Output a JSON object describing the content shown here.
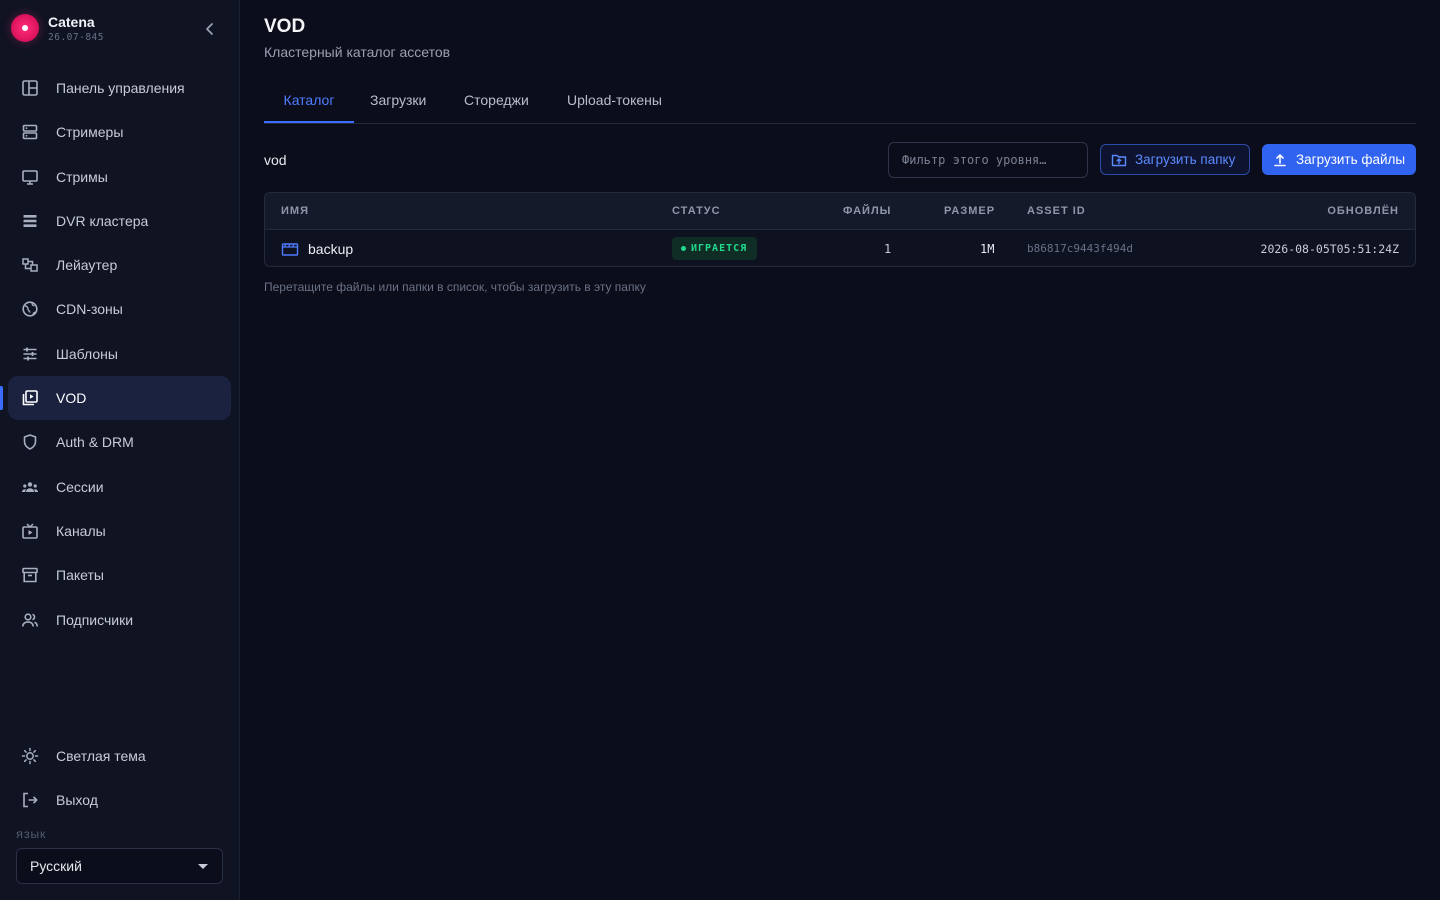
{
  "brand": {
    "name": "Catena",
    "version": "26.07-845"
  },
  "sidebar": {
    "items": [
      {
        "label": "Панель управления",
        "icon": "dashboard-icon",
        "active": false
      },
      {
        "label": "Стримеры",
        "icon": "server-icon",
        "active": false
      },
      {
        "label": "Стримы",
        "icon": "monitor-icon",
        "active": false
      },
      {
        "label": "DVR кластера",
        "icon": "stack-icon",
        "active": false
      },
      {
        "label": "Лейаутер",
        "icon": "layout-icon",
        "active": false
      },
      {
        "label": "CDN-зоны",
        "icon": "globe-icon",
        "active": false
      },
      {
        "label": "Шаблоны",
        "icon": "sliders-icon",
        "active": false
      },
      {
        "label": "VOD",
        "icon": "video-library-icon",
        "active": true
      },
      {
        "label": "Auth & DRM",
        "icon": "shield-icon",
        "active": false
      },
      {
        "label": "Сессии",
        "icon": "users-group-icon",
        "active": false
      },
      {
        "label": "Каналы",
        "icon": "tv-icon",
        "active": false
      },
      {
        "label": "Пакеты",
        "icon": "archive-icon",
        "active": false
      },
      {
        "label": "Подписчики",
        "icon": "subscribers-icon",
        "active": false
      }
    ],
    "theme_label": "Светлая тема",
    "logout_label": "Выход",
    "language_label": "ЯЗЫК",
    "language_value": "Русский"
  },
  "header": {
    "title": "VOD",
    "subtitle": "Кластерный каталог ассетов"
  },
  "tabs": [
    {
      "label": "Каталог",
      "active": true
    },
    {
      "label": "Загрузки",
      "active": false
    },
    {
      "label": "Стореджи",
      "active": false
    },
    {
      "label": "Upload-токены",
      "active": false
    }
  ],
  "toolbar": {
    "path": "vod",
    "filter_placeholder": "Фильтр этого уровня…",
    "upload_folder_label": "Загрузить папку",
    "upload_files_label": "Загрузить файлы"
  },
  "table": {
    "columns": [
      "ИМЯ",
      "СТАТУС",
      "ФАЙЛЫ",
      "РАЗМЕР",
      "ASSET ID",
      "ОБНОВЛЁН"
    ],
    "rows": [
      {
        "name": "backup",
        "status": "ИГРАЕТСЯ",
        "files": "1",
        "size": "1M",
        "asset_id": "b86817c9443f494d",
        "updated": "2026-08-05T05:51:24Z"
      }
    ]
  },
  "hint": "Перетащите файлы или папки в список, чтобы загрузить в эту папку",
  "colors": {
    "accent": "#3b6cff",
    "status_playing": "#22d98e",
    "brand": "#e0155f"
  }
}
